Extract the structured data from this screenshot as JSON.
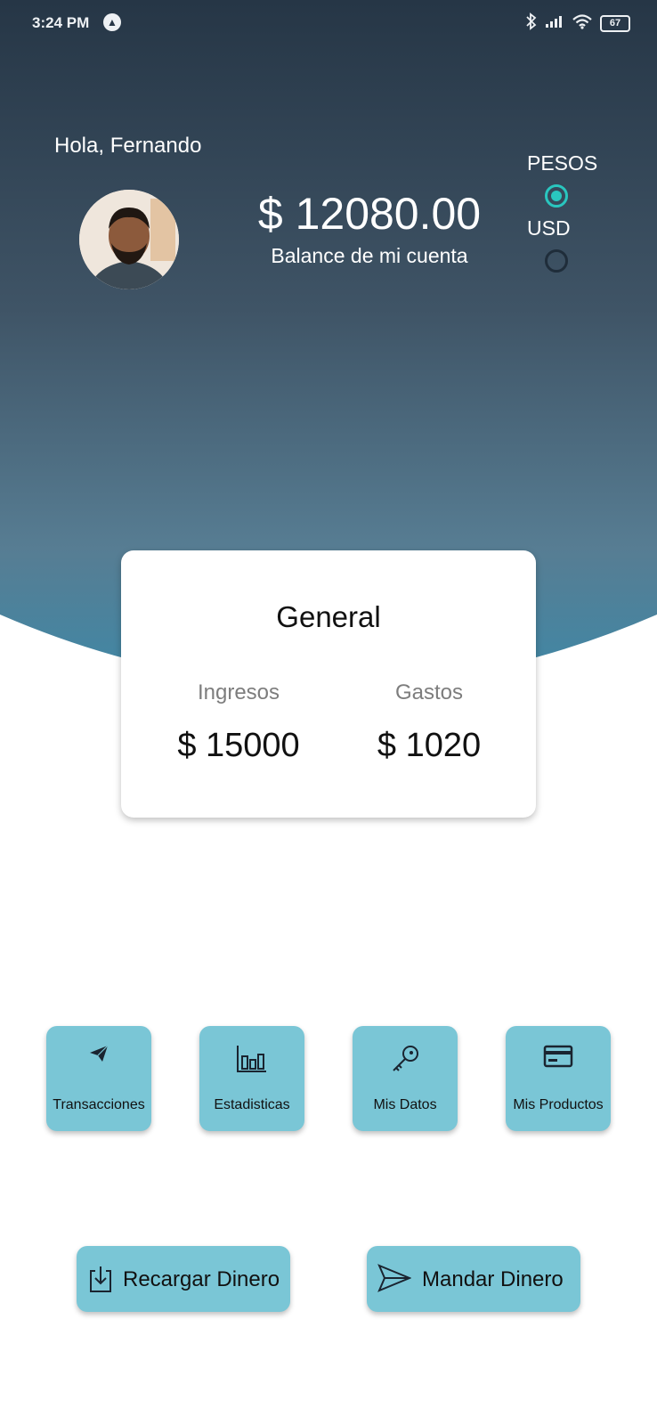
{
  "status_bar": {
    "time": "3:24 PM",
    "battery": "67"
  },
  "header": {
    "greeting": "Hola, Fernando",
    "balance_amount": "$ 12080.00",
    "balance_label": "Balance de mi cuenta"
  },
  "currency": {
    "options": [
      {
        "label": "PESOS",
        "selected": true
      },
      {
        "label": "USD",
        "selected": false
      }
    ]
  },
  "summary_card": {
    "title": "General",
    "income_label": "Ingresos",
    "income_value": "$ 15000",
    "expense_label": "Gastos",
    "expense_value": "$ 1020"
  },
  "menu_tiles": [
    {
      "label": "Transacciones",
      "icon": "paper-plane-icon"
    },
    {
      "label": "Estadisticas",
      "icon": "bar-chart-icon"
    },
    {
      "label": "Mis Datos",
      "icon": "key-icon"
    },
    {
      "label": "Mis Productos",
      "icon": "credit-card-icon"
    }
  ],
  "actions": [
    {
      "label": "Recargar Dinero",
      "icon": "download-icon"
    },
    {
      "label": "Mandar Dinero",
      "icon": "send-icon"
    }
  ],
  "colors": {
    "header_top": "#263646",
    "header_bottom": "#4a8ea8",
    "accent": "#29c6bf",
    "tile_bg": "#7ac6d6"
  }
}
